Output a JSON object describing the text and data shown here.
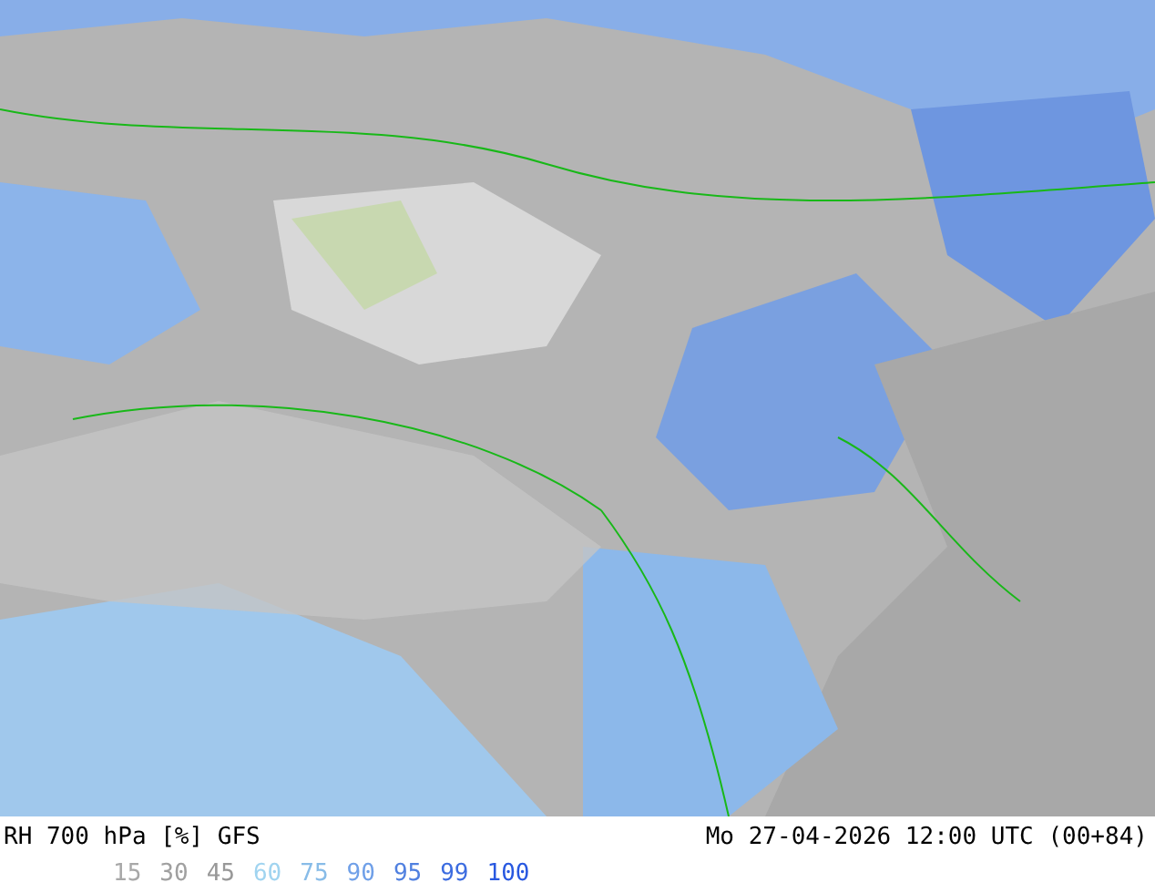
{
  "title": "RH 700 hPa [%] GFS",
  "valid_time": "Mo 27-04-2026 12:00 UTC (00+84)",
  "legend": [
    {
      "label": "15",
      "color": "#a8a8a8"
    },
    {
      "label": "30",
      "color": "#a0a0a0"
    },
    {
      "label": "45",
      "color": "#989898"
    },
    {
      "label": "60",
      "color": "#a0d4f0"
    },
    {
      "label": "75",
      "color": "#88bce8"
    },
    {
      "label": "90",
      "color": "#70a0e8"
    },
    {
      "label": "95",
      "color": "#5080e0"
    },
    {
      "label": "99",
      "color": "#3c6ce0"
    },
    {
      "label": "100",
      "color": "#2858e0"
    }
  ]
}
